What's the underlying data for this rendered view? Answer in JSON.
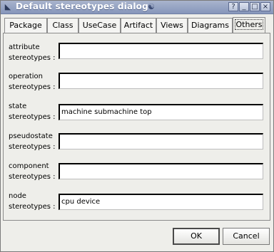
{
  "window": {
    "title": "Default stereotypes dialog"
  },
  "titlebar_buttons": {
    "help": "?",
    "minimize": "_",
    "maximize": "□",
    "close": "×"
  },
  "tabs": [
    {
      "label": "Package"
    },
    {
      "label": "Class"
    },
    {
      "label": "UseCase"
    },
    {
      "label": "Artifact"
    },
    {
      "label": "Views"
    },
    {
      "label": "Diagrams"
    },
    {
      "label": "Others",
      "active": true
    }
  ],
  "rows": [
    {
      "label1": "attribute",
      "label2": "stereotypes :",
      "value": ""
    },
    {
      "label1": "operation",
      "label2": "stereotypes :",
      "value": ""
    },
    {
      "label1": "state",
      "label2": "stereotypes :",
      "value": "machine submachine top"
    },
    {
      "label1": "pseudostate",
      "label2": "stereotypes :",
      "value": ""
    },
    {
      "label1": "component",
      "label2": "stereotypes :",
      "value": ""
    },
    {
      "label1": "node",
      "label2": "stereotypes :",
      "value": "cpu device"
    }
  ],
  "buttons": {
    "ok": "OK",
    "cancel": "Cancel"
  }
}
